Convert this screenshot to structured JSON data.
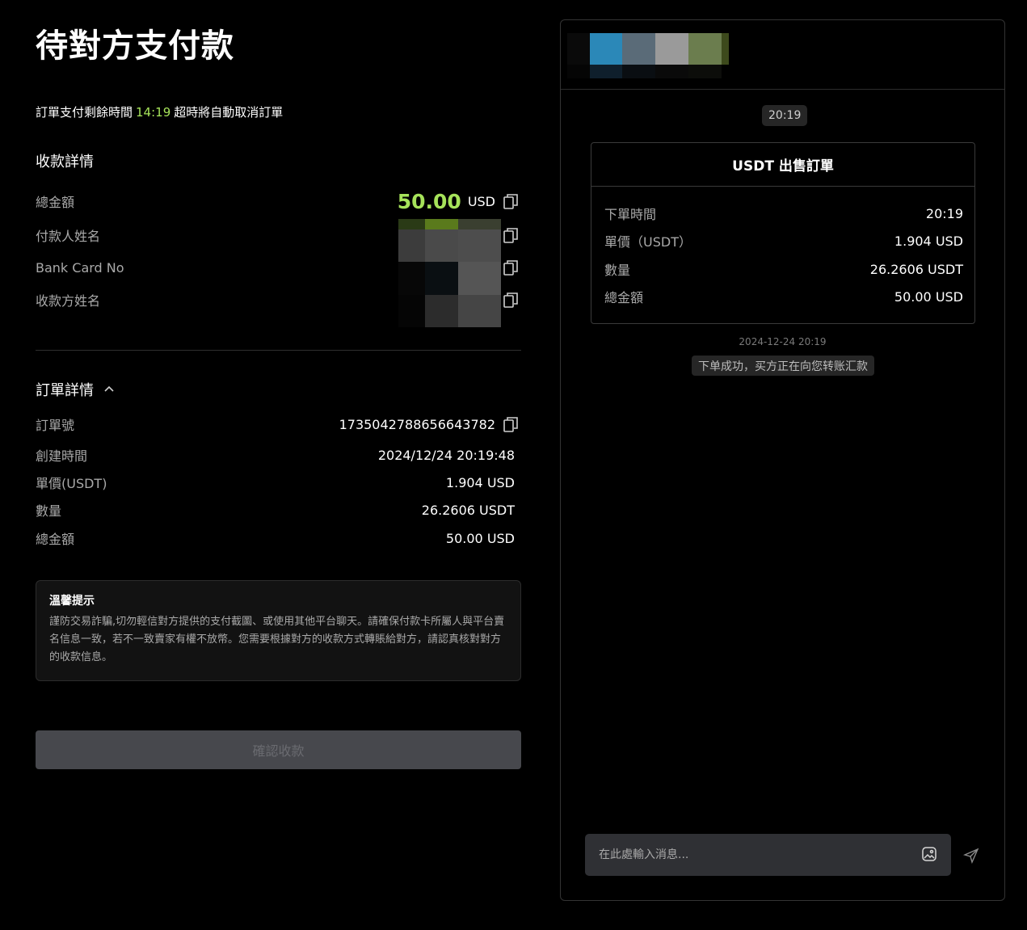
{
  "page_title": "待對方支付款",
  "countdown": {
    "prefix": "訂單支付剩餘時間",
    "time": "14:19",
    "suffix": "超時將自動取消訂單"
  },
  "payment_details": {
    "title": "收款詳情",
    "total_label": "總金額",
    "total_amount": "50.00",
    "total_unit": "USD",
    "payer_name_label": "付款人姓名",
    "bank_card_label": "Bank Card No",
    "payee_name_label": "收款方姓名"
  },
  "order_details": {
    "title": "訂單詳情",
    "rows": [
      {
        "label": "訂單號",
        "value": "1735042788656643782"
      },
      {
        "label": "創建時間",
        "value": "2024/12/24 20:19:48"
      },
      {
        "label": "單價(USDT)",
        "value": "1.904 USD"
      },
      {
        "label": "數量",
        "value": "26.2606 USDT"
      },
      {
        "label": "總金額",
        "value": "50.00 USD"
      }
    ]
  },
  "tip": {
    "title": "溫馨提示",
    "text": "謹防交易詐騙,切勿輕信對方提供的支付截圖、或使用其他平台聊天。請確保付款卡所屬人與平台賣名信息一致，若不一致賣家有權不放幣。您需要根據對方的收款方式轉賬給對方，請認真核對對方的收款信息。"
  },
  "confirm_button": "確認收款",
  "chat": {
    "time_pill": "20:19",
    "order_card": {
      "title": "USDT 出售訂單",
      "rows": [
        {
          "label": "下單時間",
          "value": "20:19"
        },
        {
          "label": "單價（USDT）",
          "value": "1.904 USD"
        },
        {
          "label": "數量",
          "value": "26.2606 USDT"
        },
        {
          "label": "總金額",
          "value": "50.00 USD"
        }
      ]
    },
    "system_time": "2024-12-24 20:19",
    "system_message": "下单成功，买方正在向您转账汇款",
    "input_placeholder": "在此處輸入消息..."
  },
  "colors": {
    "accent_green": "#a6e35a",
    "background": "#000000",
    "disabled_button": "#47484d"
  },
  "icons": [
    "copy-icon",
    "chevron-up-icon",
    "image-icon",
    "send-icon"
  ]
}
